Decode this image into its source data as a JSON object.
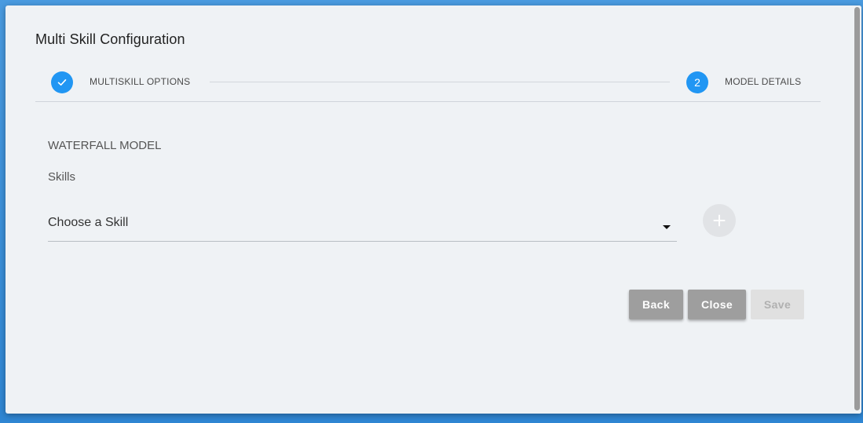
{
  "dialog": {
    "title": "Multi Skill Configuration"
  },
  "stepper": {
    "steps": [
      {
        "label": "MULTISKILL OPTIONS",
        "state": "completed",
        "icon": "check-icon"
      },
      {
        "label": "MODEL DETAILS",
        "state": "active",
        "number": "2"
      }
    ]
  },
  "form": {
    "section_title": "WATERFALL MODEL",
    "skills_label": "Skills",
    "skill_select": {
      "value": "Choose a Skill",
      "icon": "caret-down-icon"
    },
    "add_button_icon": "plus-icon"
  },
  "actions": {
    "back_label": "Back",
    "close_label": "Close",
    "save_label": "Save"
  },
  "colors": {
    "accent": "#2196f3",
    "button_gray": "#9e9e9e",
    "disabled_bg": "#e0e0e0",
    "dialog_bg": "#eff2f5"
  }
}
